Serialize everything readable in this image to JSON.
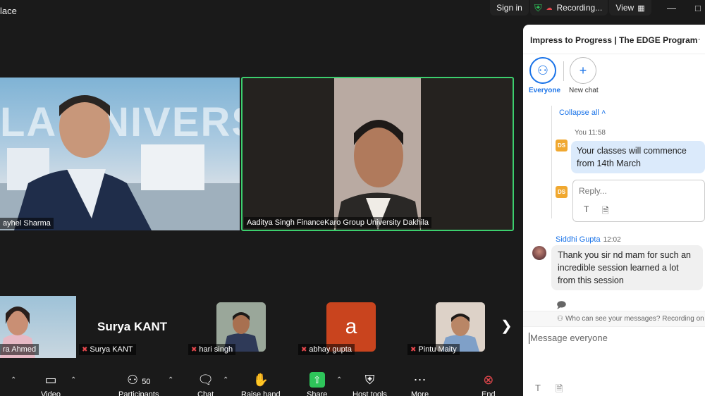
{
  "window": {
    "title_fragment": "lace",
    "sign_in": "Sign in",
    "recording": "Recording...",
    "view": "View"
  },
  "main_tiles": {
    "left": {
      "name": "ayhel Sharma",
      "bg_text": "LA UNIVERSITY"
    },
    "right": {
      "name": "Aaditya Singh FinanceKaro Group University Dakhila"
    }
  },
  "strip": {
    "featured_name": "Surya KANT",
    "tiles": [
      {
        "name": "ra Ahmed"
      },
      {
        "name": "Surya KANT"
      },
      {
        "name": "hari singh"
      },
      {
        "name": "abhay gupta",
        "avatar_letter": "a"
      },
      {
        "name": "Pintu Maity"
      }
    ]
  },
  "toolbar": {
    "video": "Video",
    "participants": "Participants",
    "participants_count": "50",
    "chat": "Chat",
    "raise_hand": "Raise hand",
    "share": "Share",
    "host_tools": "Host tools",
    "more": "More",
    "end": "End"
  },
  "chat": {
    "title": "Impress to Progress | The EDGE Program",
    "tabs": [
      {
        "label": "Everyone",
        "icon": "people-icon"
      },
      {
        "label": "New chat",
        "icon": "plus-icon"
      }
    ],
    "collapse_all": "Collapse all",
    "you_label": "You",
    "you_time": "11:58",
    "you_initials": "DS",
    "you_message": "Your classes will commence from 14th March",
    "reply_placeholder": "Reply...",
    "sender_name": "Siddhi Gupta",
    "sender_time": "12:02",
    "sender_message": "Thank you sir nd mam for such an incredible session learned a lot from this session",
    "privacy": "Who can see your messages? Recording on",
    "input_placeholder": "Message everyone"
  },
  "colors": {
    "accent": "#1a73e8",
    "active_speaker": "#3ccf6e",
    "share_green": "#2ec55a",
    "end_red": "#e5484d"
  }
}
